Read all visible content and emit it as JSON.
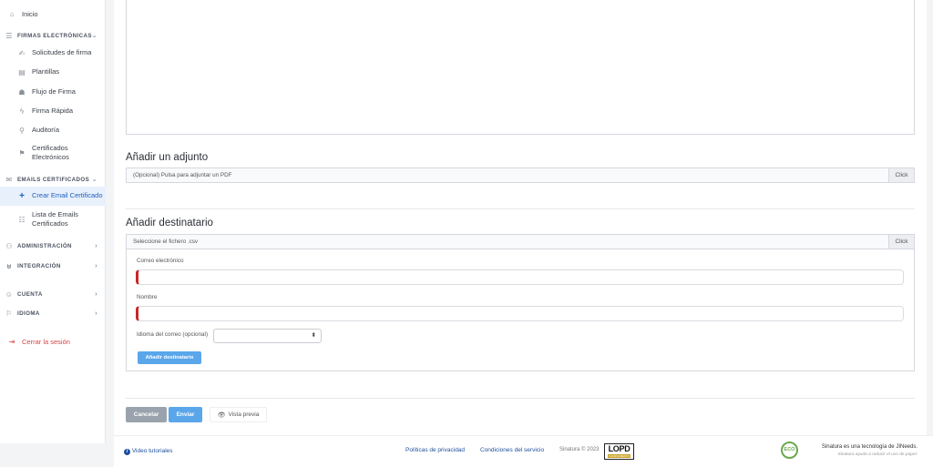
{
  "sidebar": {
    "home": "Inicio",
    "firmas_header": "FIRMAS ELECTRÓNICAS",
    "firmas_items": [
      "Solicitudes de firma",
      "Plantillas",
      "Flujo de Firma",
      "Firma Rápida",
      "Auditoría"
    ],
    "certificados_1": "Certificados",
    "certificados_2": "Electrónicos",
    "emails_header": "EMAILS CERTIFICADOS",
    "crear_email": "Crear Email Certificado",
    "lista_1": "Lista de Emails",
    "lista_2": "Certificados",
    "administracion": "ADMINISTRACIÓN",
    "integracion": "INTEGRACIÓN",
    "cuenta": "CUENTA",
    "idioma": "IDIOMA",
    "logout": "Cerrar la sesión"
  },
  "attachment": {
    "title": "Añadir un adjunto",
    "placeholder": "(Opcional) Pulsa para adjuntar un PDF",
    "button": "Click"
  },
  "recipient": {
    "title": "Añadir destinatario",
    "file_placeholder": "Seleccione el fichero .csv",
    "file_button": "Click",
    "email_label": "Correo electrónico",
    "name_label": "Nombre",
    "language_label": "Idioma del correo (opcional)",
    "add_button": "Añadir destinatario"
  },
  "actions": {
    "cancel": "Cancelar",
    "send": "Enviar",
    "preview": "Vista previa"
  },
  "footer": {
    "tutorials": "Video tutoriales",
    "privacy": "Políticas de privacidad",
    "terms": "Condiciones del servicio",
    "copyright": "Sinatura © 2023",
    "lopd_logo": "LOPD",
    "lopd_sub": "CUMPLIMIENTO",
    "eco_logo": "ECO",
    "tagline_1": "Sinatura es una tecnología de JINeeds.",
    "tagline_2": "Sinatura ayuda a reducir el uso de papel."
  },
  "colors": {
    "primary": "#5aa6ea",
    "active_bg": "#e8f0fb",
    "required": "#c62828",
    "cancel": "#9aa3ad",
    "link": "#1f4f9c"
  }
}
